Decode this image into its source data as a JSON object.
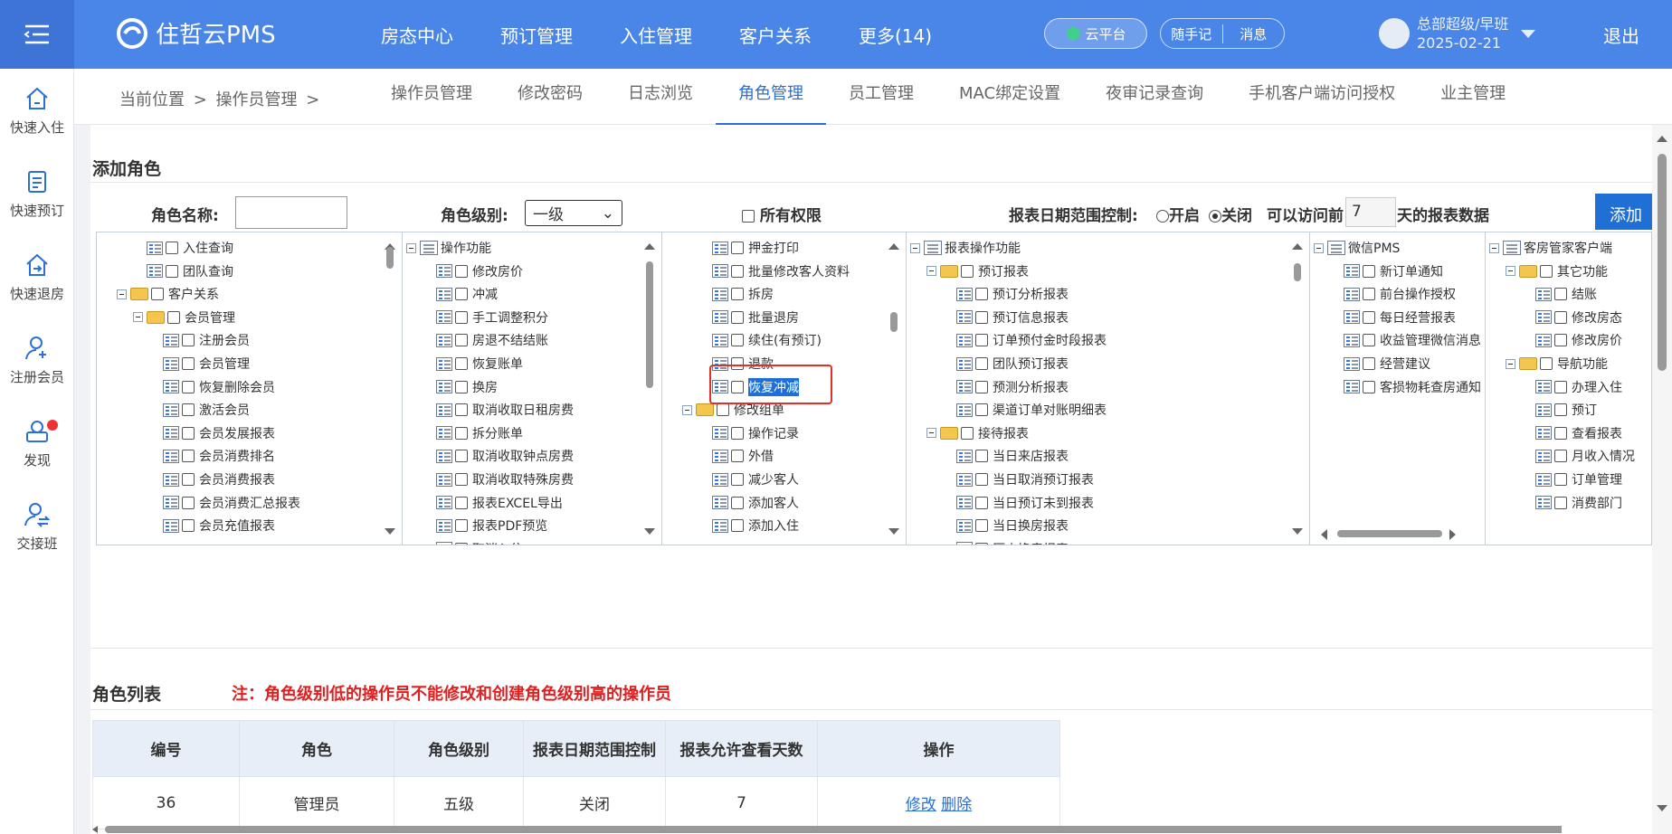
{
  "header": {
    "logo": "住哲云PMS",
    "nav": [
      "房态中心",
      "预订管理",
      "入住管理",
      "客户关系",
      "更多(14)"
    ],
    "cloud": "云平台",
    "notes": "随手记",
    "messages": "消息",
    "user_name": "总部超级/早班",
    "user_date": "2025-02-21",
    "logout": "退出"
  },
  "sidebar": [
    {
      "label": "快速入住",
      "icon": "home-icon"
    },
    {
      "label": "快速预订",
      "icon": "book-icon"
    },
    {
      "label": "快速退房",
      "icon": "checkout-icon"
    },
    {
      "label": "注册会员",
      "icon": "add-user-icon"
    },
    {
      "label": "发现",
      "icon": "discover-icon"
    },
    {
      "label": "交接班",
      "icon": "handover-icon"
    }
  ],
  "breadcrumb": "当前位置 > 操作员管理 >",
  "tabs": [
    "操作员管理",
    "修改密码",
    "日志浏览",
    "角色管理",
    "员工管理",
    "MAC绑定设置",
    "夜审记录查询",
    "手机客户端访问授权",
    "业主管理"
  ],
  "active_tab": "角色管理",
  "add_role": {
    "title": "添加角色",
    "name_label": "角色名称:",
    "level_label": "角色级别:",
    "level_value": "一级",
    "all_perm": "所有权限",
    "date_range_label": "报表日期范围控制:",
    "open": "开启",
    "close": "关闭",
    "access_prefix": "可以访问前",
    "days_value": "7",
    "access_suffix": "天的报表数据",
    "add_button": "添加角色"
  },
  "tree_panels": [
    {
      "nodes": [
        {
          "t": "入住查询",
          "k": "item",
          "x": 55
        },
        {
          "t": "团队查询",
          "k": "item",
          "x": 55
        },
        {
          "t": "客户关系",
          "k": "folder",
          "x": 22
        },
        {
          "t": "会员管理",
          "k": "folder",
          "x": 40
        },
        {
          "t": "注册会员",
          "k": "item",
          "x": 73
        },
        {
          "t": "会员管理",
          "k": "item",
          "x": 73
        },
        {
          "t": "恢复删除会员",
          "k": "item",
          "x": 73
        },
        {
          "t": "激活会员",
          "k": "item",
          "x": 73
        },
        {
          "t": "会员发展报表",
          "k": "item",
          "x": 73
        },
        {
          "t": "会员消费排名",
          "k": "item",
          "x": 73
        },
        {
          "t": "会员消费报表",
          "k": "item",
          "x": 73
        },
        {
          "t": "会员消费汇总报表",
          "k": "item",
          "x": 73
        },
        {
          "t": "会员充值报表",
          "k": "item",
          "x": 73
        }
      ]
    },
    {
      "nodes": [
        {
          "t": "操作功能",
          "k": "root",
          "x": 4
        },
        {
          "t": "修改房价",
          "k": "item",
          "x": 37
        },
        {
          "t": "冲减",
          "k": "item",
          "x": 37
        },
        {
          "t": "手工调整积分",
          "k": "item",
          "x": 37
        },
        {
          "t": "房退不结结账",
          "k": "item",
          "x": 37
        },
        {
          "t": "恢复账单",
          "k": "item",
          "x": 37
        },
        {
          "t": "换房",
          "k": "item",
          "x": 37
        },
        {
          "t": "取消收取日租房费",
          "k": "item",
          "x": 37
        },
        {
          "t": "拆分账单",
          "k": "item",
          "x": 37
        },
        {
          "t": "取消收取钟点房费",
          "k": "item",
          "x": 37
        },
        {
          "t": "取消收取特殊房费",
          "k": "item",
          "x": 37
        },
        {
          "t": "报表EXCEL导出",
          "k": "item",
          "x": 37
        },
        {
          "t": "报表PDF预览",
          "k": "item",
          "x": 37
        },
        {
          "t": "取消入住",
          "k": "item",
          "x": 37
        }
      ]
    },
    {
      "nodes": [
        {
          "t": "押金打印",
          "k": "item",
          "x": 55
        },
        {
          "t": "批量修改客人资料",
          "k": "item",
          "x": 55
        },
        {
          "t": "拆房",
          "k": "item",
          "x": 55
        },
        {
          "t": "批量退房",
          "k": "item",
          "x": 55
        },
        {
          "t": "续住(有预订)",
          "k": "item",
          "x": 55
        },
        {
          "t": "退款",
          "k": "item",
          "x": 55
        },
        {
          "t": "恢复冲减",
          "k": "item",
          "x": 55
        },
        {
          "t": "修改组单",
          "k": "folder",
          "x": 22
        },
        {
          "t": "操作记录",
          "k": "item",
          "x": 55
        },
        {
          "t": "外借",
          "k": "item",
          "x": 55
        },
        {
          "t": "减少客人",
          "k": "item",
          "x": 55
        },
        {
          "t": "添加客人",
          "k": "item",
          "x": 55
        },
        {
          "t": "添加入住",
          "k": "item",
          "x": 55
        }
      ]
    },
    {
      "nodes": [
        {
          "t": "报表操作功能",
          "k": "root",
          "x": 4
        },
        {
          "t": "预订报表",
          "k": "folder",
          "x": 22
        },
        {
          "t": "预订分析报表",
          "k": "item",
          "x": 55
        },
        {
          "t": "预订信息报表",
          "k": "item",
          "x": 55
        },
        {
          "t": "订单预付金时段报表",
          "k": "item",
          "x": 55
        },
        {
          "t": "团队预订报表",
          "k": "item",
          "x": 55
        },
        {
          "t": "预测分析报表",
          "k": "item",
          "x": 55
        },
        {
          "t": "渠道订单对账明细表",
          "k": "item",
          "x": 55
        },
        {
          "t": "接待报表",
          "k": "folder",
          "x": 22
        },
        {
          "t": "当日来店报表",
          "k": "item",
          "x": 55
        },
        {
          "t": "当日取消预订报表",
          "k": "item",
          "x": 55
        },
        {
          "t": "当日预订未到报表",
          "k": "item",
          "x": 55
        },
        {
          "t": "当日换房报表",
          "k": "item",
          "x": 55
        },
        {
          "t": "历史换房报表",
          "k": "item",
          "x": 55
        }
      ]
    },
    {
      "nodes": [
        {
          "t": "微信PMS",
          "k": "root",
          "x": 4
        },
        {
          "t": "新订单通知",
          "k": "item",
          "x": 37
        },
        {
          "t": "前台操作授权",
          "k": "item",
          "x": 37
        },
        {
          "t": "每日经营报表",
          "k": "item",
          "x": 37
        },
        {
          "t": "收益管理微信消息",
          "k": "item",
          "x": 37
        },
        {
          "t": "经营建议",
          "k": "item",
          "x": 37
        },
        {
          "t": "客损物耗查房通知",
          "k": "item",
          "x": 37
        }
      ]
    },
    {
      "nodes": [
        {
          "t": "客房管家客户端",
          "k": "root",
          "x": 4
        },
        {
          "t": "其它功能",
          "k": "folder",
          "x": 22
        },
        {
          "t": "结账",
          "k": "item",
          "x": 55
        },
        {
          "t": "修改房态",
          "k": "item",
          "x": 55
        },
        {
          "t": "修改房价",
          "k": "item",
          "x": 55
        },
        {
          "t": "导航功能",
          "k": "folder",
          "x": 22
        },
        {
          "t": "办理入住",
          "k": "item",
          "x": 55
        },
        {
          "t": "预订",
          "k": "item",
          "x": 55
        },
        {
          "t": "查看报表",
          "k": "item",
          "x": 55
        },
        {
          "t": "月收入情况",
          "k": "item",
          "x": 55
        },
        {
          "t": "订单管理",
          "k": "item",
          "x": 55
        },
        {
          "t": "消费部门",
          "k": "item",
          "x": 55
        }
      ]
    }
  ],
  "selected_node": "恢复冲减",
  "role_list": {
    "title": "角色列表",
    "note": "注：角色级别低的操作员不能修改和创建角色级别高的操作员",
    "columns": [
      "编号",
      "角色",
      "角色级别",
      "报表日期范围控制",
      "报表允许查看天数",
      "操作"
    ],
    "rows": [
      {
        "id": "36",
        "role": "管理员",
        "level": "五级",
        "date_control": "关闭",
        "days": "7",
        "edit": "修改",
        "delete": "删除"
      }
    ]
  },
  "colors": {
    "header": "#4a86e8",
    "accent": "#2c6fd6",
    "warning": "#e02020",
    "highlight": "#1e6fd9"
  }
}
